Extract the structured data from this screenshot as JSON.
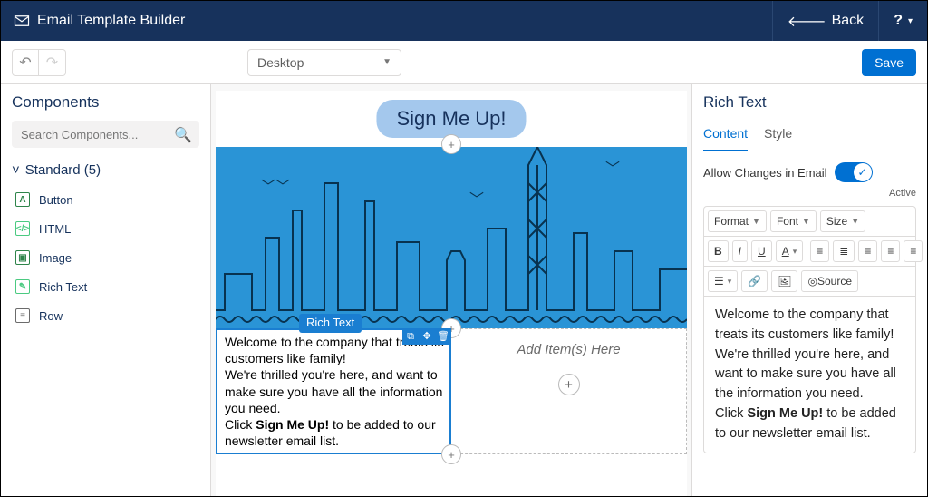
{
  "topbar": {
    "title": "Email Template Builder",
    "back_label": "Back",
    "help_label": "?"
  },
  "toolbar": {
    "device_label": "Desktop",
    "save_label": "Save"
  },
  "left_panel": {
    "title": "Components",
    "search_placeholder": "Search Components...",
    "group_label": "Standard (5)",
    "items": [
      {
        "label": "Button"
      },
      {
        "label": "HTML"
      },
      {
        "label": "Image"
      },
      {
        "label": "Rich Text"
      },
      {
        "label": "Row"
      }
    ]
  },
  "canvas": {
    "cta_label": "Sign Me Up!",
    "rich_text_badge": "Rich Text",
    "rich_text_line1": "Welcome to the company that treats its customers like family!",
    "rich_text_line2": "We're thrilled you're here, and want to make sure you have all the information you need.",
    "rich_text_line3a": "Click ",
    "rich_text_line3b": "Sign Me Up!",
    "rich_text_line3c": " to be added to our newsletter email list.",
    "dropzone_label": "Add Item(s) Here"
  },
  "right_panel": {
    "title": "Rich Text",
    "tabs": [
      {
        "label": "Content"
      },
      {
        "label": "Style"
      }
    ],
    "toggle_label": "Allow Changes in Email",
    "toggle_state": "Active",
    "rte": {
      "format": "Format",
      "font": "Font",
      "size": "Size",
      "source": "Source",
      "body_p1": "Welcome to the company that treats its customers like family! We're thrilled you're here, and want to make sure you have all the information you need.",
      "body_p2a": "Click ",
      "body_p2b": "Sign Me Up!",
      "body_p2c": " to be added to our newsletter email list."
    }
  }
}
